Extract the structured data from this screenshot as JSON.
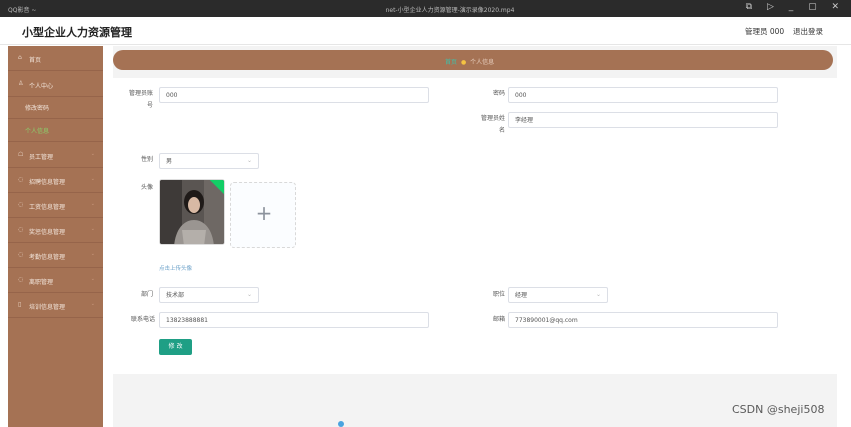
{
  "player": {
    "app_name": "QQ影音 ~",
    "video_title": "net-小型企业人力资源管理-演示录像2020.mp4",
    "controls": "⧉ ▷ _ ▢ ✕"
  },
  "app": {
    "title": "小型企业人力资源管理"
  },
  "header": {
    "user": "管理员 000",
    "logout": "退出登录"
  },
  "sidebar": {
    "items": [
      {
        "icon": "⌂",
        "label": "首页"
      },
      {
        "icon": "♙",
        "label": "个人中心"
      },
      {
        "icon": "",
        "label": "修改密码"
      },
      {
        "icon": "",
        "label": "个人信息"
      },
      {
        "icon": "☖",
        "label": "员工管理"
      },
      {
        "icon": "◌",
        "label": "招聘信息管理"
      },
      {
        "icon": "◌",
        "label": "工资信息管理"
      },
      {
        "icon": "◌",
        "label": "奖惩信息管理"
      },
      {
        "icon": "◌",
        "label": "考勤信息管理"
      },
      {
        "icon": "◌",
        "label": "离职管理"
      },
      {
        "icon": "▯",
        "label": "培训信息管理"
      }
    ],
    "arrow": "⌄"
  },
  "breadcrumb": {
    "home": "首页",
    "separator": "●",
    "current": "个人信息"
  },
  "form": {
    "account_label_1": "管理员账",
    "account_label_2": "号",
    "account_value": "000",
    "password_label": "密码",
    "password_value": "000",
    "name_label_1": "管理员姓",
    "name_label_2": "名",
    "name_value": "李经理",
    "gender_label": "性别",
    "gender_value": "男",
    "avatar_label": "头像",
    "upload_plus": "+",
    "upload_hint": "点击上传头像",
    "dept_label": "部门",
    "dept_value": "技术部",
    "position_label": "职位",
    "position_value": "经理",
    "phone_label": "联系电话",
    "phone_value": "13823888881",
    "email_label": "邮箱",
    "email_value": "773890001@qq.com",
    "submit_label": "修 改",
    "chevron": "⌄"
  },
  "watermark": "CSDN @sheji508",
  "colors": {
    "sidebar": "#a57254",
    "accent": "#1f9f85",
    "active_text": "#8bd06b"
  }
}
